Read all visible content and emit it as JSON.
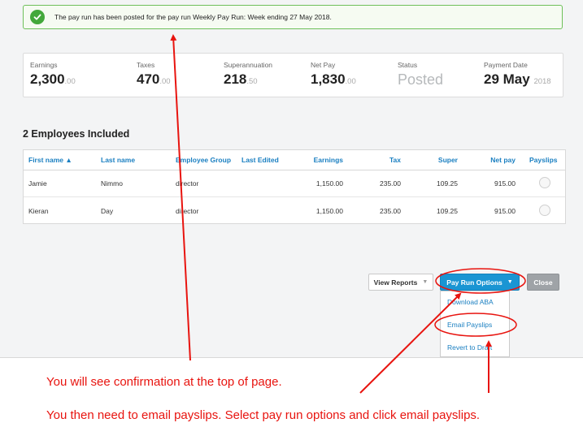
{
  "banner": {
    "message": "The pay run has been posted for the pay run Weekly Pay Run: Week ending 27 May 2018."
  },
  "summary": {
    "earnings": {
      "label": "Earnings",
      "whole": "2,300",
      "decimal": ".00"
    },
    "taxes": {
      "label": "Taxes",
      "whole": "470",
      "decimal": ".00"
    },
    "superannuation": {
      "label": "Superannuation",
      "whole": "218",
      "decimal": ".50"
    },
    "net_pay": {
      "label": "Net Pay",
      "whole": "1,830",
      "decimal": ".00"
    },
    "status": {
      "label": "Status",
      "value": "Posted"
    },
    "payment_date": {
      "label": "Payment Date",
      "day_month": "29 May",
      "year": "2018"
    }
  },
  "employees": {
    "heading": "2 Employees Included",
    "columns": {
      "first_name": "First name ▲",
      "last_name": "Last name",
      "employee_group": "Employee Group",
      "last_edited": "Last Edited",
      "earnings": "Earnings",
      "tax": "Tax",
      "super": "Super",
      "net_pay": "Net pay",
      "payslips": "Payslips"
    },
    "rows": [
      {
        "first_name": "Jamie",
        "last_name": "Nimmo",
        "group": "director",
        "last_edited": "",
        "earnings": "1,150.00",
        "tax": "235.00",
        "super": "109.25",
        "net_pay": "915.00"
      },
      {
        "first_name": "Kieran",
        "last_name": "Day",
        "group": "director",
        "last_edited": "",
        "earnings": "1,150.00",
        "tax": "235.00",
        "super": "109.25",
        "net_pay": "915.00"
      }
    ]
  },
  "actions": {
    "view_reports": "View Reports",
    "pay_run_options": "Pay Run Options",
    "close": "Close",
    "dropdown": {
      "download_aba": "Download ABA",
      "email_payslips": "Email Payslips",
      "revert_to_draft": "Revert to Draft"
    }
  },
  "annotations": {
    "line1": "You will see confirmation at the top of page.",
    "line2": "You then need to email payslips. Select pay run options and click email payslips."
  },
  "colors": {
    "accent": "#1a95d3",
    "success": "#43a83b",
    "annotation": "#e8140f"
  }
}
